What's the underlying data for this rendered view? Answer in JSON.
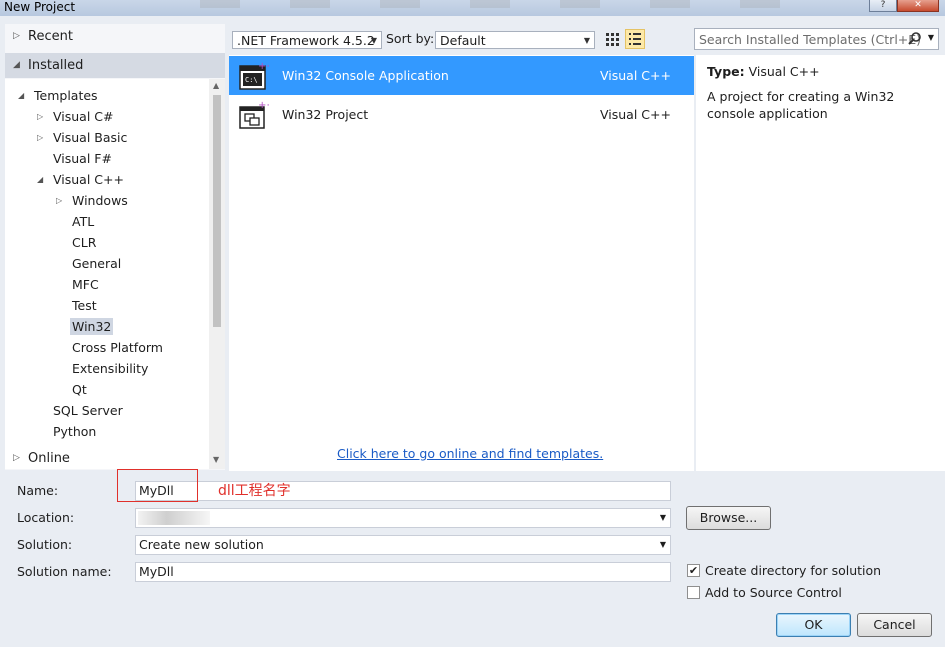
{
  "window": {
    "title": "New Project"
  },
  "nav": {
    "recent": "Recent",
    "installed": "Installed",
    "online": "Online",
    "tree": [
      {
        "label": "Templates",
        "level": 0,
        "expander": "open"
      },
      {
        "label": "Visual C#",
        "level": 1,
        "expander": "closed"
      },
      {
        "label": "Visual Basic",
        "level": 1,
        "expander": "closed"
      },
      {
        "label": "Visual F#",
        "level": 1,
        "expander": "none"
      },
      {
        "label": "Visual C++",
        "level": 1,
        "expander": "open"
      },
      {
        "label": "Windows",
        "level": 2,
        "expander": "closed"
      },
      {
        "label": "ATL",
        "level": 2,
        "expander": "none"
      },
      {
        "label": "CLR",
        "level": 2,
        "expander": "none"
      },
      {
        "label": "General",
        "level": 2,
        "expander": "none"
      },
      {
        "label": "MFC",
        "level": 2,
        "expander": "none"
      },
      {
        "label": "Test",
        "level": 2,
        "expander": "none"
      },
      {
        "label": "Win32",
        "level": 2,
        "expander": "none",
        "selected": true
      },
      {
        "label": "Cross Platform",
        "level": 2,
        "expander": "none"
      },
      {
        "label": "Extensibility",
        "level": 2,
        "expander": "none"
      },
      {
        "label": "Qt",
        "level": 2,
        "expander": "none"
      },
      {
        "label": "SQL Server",
        "level": 1,
        "expander": "none"
      },
      {
        "label": "Python",
        "level": 1,
        "expander": "none"
      }
    ]
  },
  "toolbar": {
    "framework": ".NET Framework 4.5.2",
    "sort_label": "Sort by:",
    "sort_value": "Default",
    "search_placeholder": "Search Installed Templates (Ctrl+E)"
  },
  "templates": [
    {
      "name": "Win32 Console Application",
      "lang": "Visual C++",
      "selected": true,
      "icon": "console-app-icon"
    },
    {
      "name": "Win32 Project",
      "lang": "Visual C++",
      "selected": false,
      "icon": "win32-project-icon"
    }
  ],
  "online_link": "Click here to go online and find templates.",
  "details": {
    "type_label": "Type:",
    "type_value": "Visual C++",
    "description": "A project for creating a Win32 console application"
  },
  "form": {
    "name_label": "Name:",
    "name_value": "MyDll",
    "location_label": "Location:",
    "location_value": "",
    "solution_label": "Solution:",
    "solution_value": "Create new solution",
    "solution_name_label": "Solution name:",
    "solution_name_value": "MyDll",
    "browse": "Browse...",
    "create_dir": "Create directory for solution",
    "create_dir_checked": true,
    "source_control": "Add to Source Control",
    "source_control_checked": false,
    "ok": "OK",
    "cancel": "Cancel"
  },
  "annotation": "dll工程名字",
  "colors": {
    "selection": "#3399ff",
    "annotation": "#e0302b",
    "link": "#1a5bc6"
  }
}
